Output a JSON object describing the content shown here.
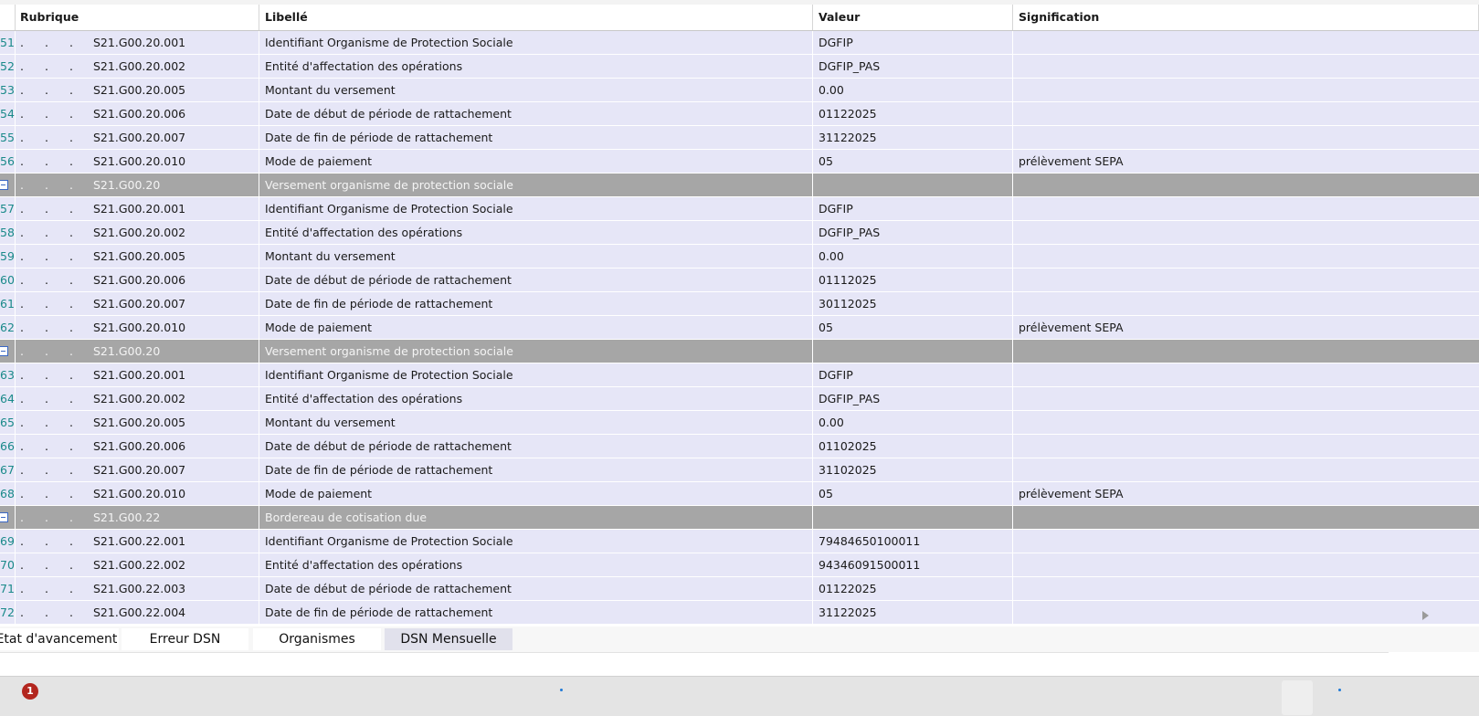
{
  "columns": {
    "rubrique": "Rubrique",
    "libelle": "Libellé",
    "valeur": "Valeur",
    "signification": "Signification"
  },
  "rows": [
    {
      "type": "data",
      "num": "51",
      "code": "S21.G00.20.001",
      "libelle": "Identifiant Organisme de Protection Sociale",
      "valeur": "DGFIP",
      "signification": ""
    },
    {
      "type": "data",
      "num": "52",
      "code": "S21.G00.20.002",
      "libelle": "Entité d'affectation des opérations",
      "valeur": "DGFIP_PAS",
      "signification": ""
    },
    {
      "type": "data",
      "num": "53",
      "code": "S21.G00.20.005",
      "libelle": "Montant du versement",
      "valeur": "0.00",
      "signification": ""
    },
    {
      "type": "data",
      "num": "54",
      "code": "S21.G00.20.006",
      "libelle": "Date de début de période de rattachement",
      "valeur": "01122025",
      "signification": ""
    },
    {
      "type": "data",
      "num": "55",
      "code": "S21.G00.20.007",
      "libelle": "Date de fin de période de rattachement",
      "valeur": "31122025",
      "signification": ""
    },
    {
      "type": "data",
      "num": "56",
      "code": "S21.G00.20.010",
      "libelle": "Mode de paiement",
      "valeur": "05",
      "signification": "prélèvement SEPA"
    },
    {
      "type": "group",
      "num": "",
      "code": "S21.G00.20",
      "libelle": "Versement organisme de protection sociale",
      "valeur": "",
      "signification": ""
    },
    {
      "type": "data",
      "num": "57",
      "code": "S21.G00.20.001",
      "libelle": "Identifiant Organisme de Protection Sociale",
      "valeur": "DGFIP",
      "signification": ""
    },
    {
      "type": "data",
      "num": "58",
      "code": "S21.G00.20.002",
      "libelle": "Entité d'affectation des opérations",
      "valeur": "DGFIP_PAS",
      "signification": ""
    },
    {
      "type": "data",
      "num": "59",
      "code": "S21.G00.20.005",
      "libelle": "Montant du versement",
      "valeur": "0.00",
      "signification": ""
    },
    {
      "type": "data",
      "num": "60",
      "code": "S21.G00.20.006",
      "libelle": "Date de début de période de rattachement",
      "valeur": "01112025",
      "signification": ""
    },
    {
      "type": "data",
      "num": "61",
      "code": "S21.G00.20.007",
      "libelle": "Date de fin de période de rattachement",
      "valeur": "30112025",
      "signification": ""
    },
    {
      "type": "data",
      "num": "62",
      "code": "S21.G00.20.010",
      "libelle": "Mode de paiement",
      "valeur": "05",
      "signification": "prélèvement SEPA"
    },
    {
      "type": "group",
      "num": "",
      "code": "S21.G00.20",
      "libelle": "Versement organisme de protection sociale",
      "valeur": "",
      "signification": ""
    },
    {
      "type": "data",
      "num": "63",
      "code": "S21.G00.20.001",
      "libelle": "Identifiant Organisme de Protection Sociale",
      "valeur": "DGFIP",
      "signification": ""
    },
    {
      "type": "data",
      "num": "64",
      "code": "S21.G00.20.002",
      "libelle": "Entité d'affectation des opérations",
      "valeur": "DGFIP_PAS",
      "signification": ""
    },
    {
      "type": "data",
      "num": "65",
      "code": "S21.G00.20.005",
      "libelle": "Montant du versement",
      "valeur": "0.00",
      "signification": ""
    },
    {
      "type": "data",
      "num": "66",
      "code": "S21.G00.20.006",
      "libelle": "Date de début de période de rattachement",
      "valeur": "01102025",
      "signification": ""
    },
    {
      "type": "data",
      "num": "67",
      "code": "S21.G00.20.007",
      "libelle": "Date de fin de période de rattachement",
      "valeur": "31102025",
      "signification": ""
    },
    {
      "type": "data",
      "num": "68",
      "code": "S21.G00.20.010",
      "libelle": "Mode de paiement",
      "valeur": "05",
      "signification": "prélèvement SEPA"
    },
    {
      "type": "group",
      "num": "",
      "code": "S21.G00.22",
      "libelle": "Bordereau de cotisation due",
      "valeur": "",
      "signification": ""
    },
    {
      "type": "data",
      "num": "69",
      "code": "S21.G00.22.001",
      "libelle": "Identifiant Organisme de Protection Sociale",
      "valeur": "79484650100011",
      "signification": ""
    },
    {
      "type": "data",
      "num": "70",
      "code": "S21.G00.22.002",
      "libelle": "Entité d'affectation des opérations",
      "valeur": "94346091500011",
      "signification": ""
    },
    {
      "type": "data",
      "num": "71",
      "code": "S21.G00.22.003",
      "libelle": "Date de début de période de rattachement",
      "valeur": "01122025",
      "signification": ""
    },
    {
      "type": "data",
      "num": "72",
      "code": "S21.G00.22.004",
      "libelle": "Date de fin de période de rattachement",
      "valeur": "31122025",
      "signification": ""
    }
  ],
  "tabs": [
    {
      "label": "Etat d'avancement",
      "active": false
    },
    {
      "label": "Erreur DSN",
      "active": false
    },
    {
      "label": "Organismes",
      "active": false
    },
    {
      "label": "DSN Mensuelle",
      "active": true
    }
  ],
  "status": {
    "notification_count": "1"
  },
  "colors": {
    "row_bg": "#e6e6f7",
    "group_bg": "#a6a6a6",
    "badge": "#b3261e"
  }
}
